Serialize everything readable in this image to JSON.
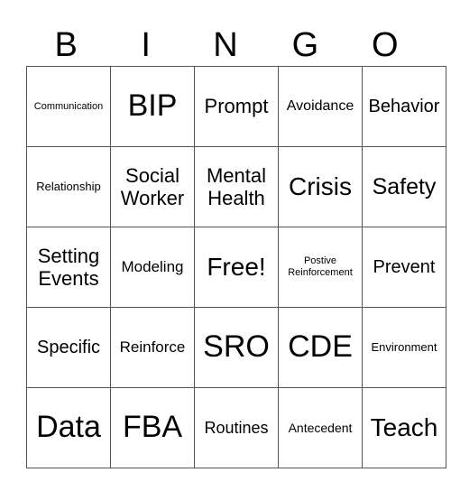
{
  "header": [
    "B",
    "I",
    "N",
    "G",
    "O"
  ],
  "rows": [
    [
      "Communication",
      "BIP",
      "Prompt",
      "Avoidance",
      "Behavior"
    ],
    [
      "Relationship",
      "Social Worker",
      "Mental Health",
      "Crisis",
      "Safety"
    ],
    [
      "Setting Events",
      "Modeling",
      "Free!",
      "Postive Reinforcement",
      "Prevent"
    ],
    [
      "Specific",
      "Reinforce",
      "SRO",
      "CDE",
      "Environment"
    ],
    [
      "Data",
      "FBA",
      "Routines",
      "Antecedent",
      "Teach"
    ]
  ]
}
